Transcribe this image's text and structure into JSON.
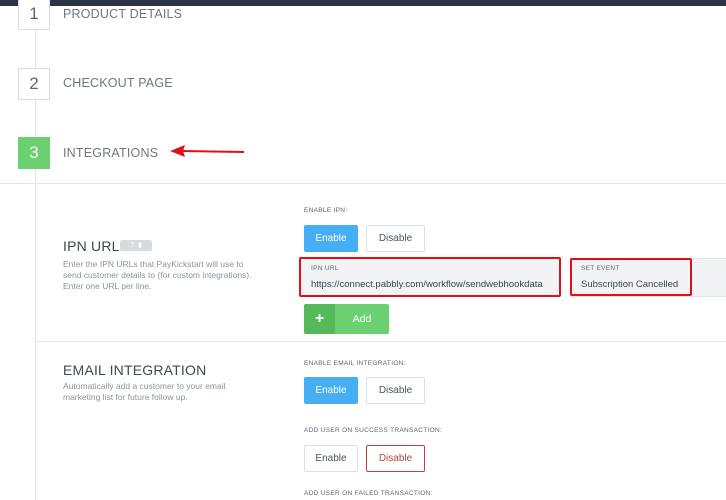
{
  "steps": [
    {
      "number": "1",
      "title": "PRODUCT DETAILS"
    },
    {
      "number": "2",
      "title": "CHECKOUT PAGE"
    },
    {
      "number": "3",
      "title": "INTEGRATIONS"
    }
  ],
  "ipn": {
    "title": "IPN URL",
    "description_lines": [
      "Enter the IPN URLs that PayKickstart will use to",
      "send customer details to (for custom integrations).",
      "Enter one URL per line."
    ],
    "help_badge": {
      "q": "?",
      "icon": "chat-icon"
    },
    "enable_label": "ENABLE IPN:",
    "enable_button": "Enable",
    "disable_button": "Disable",
    "url_label": "IPN URL",
    "url_value": "https://connect.pabbly.com/workflow/sendwebhookdata",
    "event_label": "SET EVENT",
    "event_value": "Subscription Cancelled",
    "add_button": "Add"
  },
  "email": {
    "title": "EMAIL INTEGRATION",
    "description_lines": [
      "Automatically add a customer to your email",
      "marketing list for future follow up."
    ],
    "enable_label": "ENABLE EMAIL INTEGRATION:",
    "enable_button": "Enable",
    "disable_button": "Disable",
    "success_label": "ADD USER ON SUCCESS TRANSACTION:",
    "success_enable": "Enable",
    "success_disable": "Disable",
    "failed_label": "ADD USER ON FAILED TRANSACTION:"
  },
  "colors": {
    "accent_green": "#6bd06f",
    "primary_blue": "#45aef4",
    "highlight_red": "#e0101a"
  }
}
